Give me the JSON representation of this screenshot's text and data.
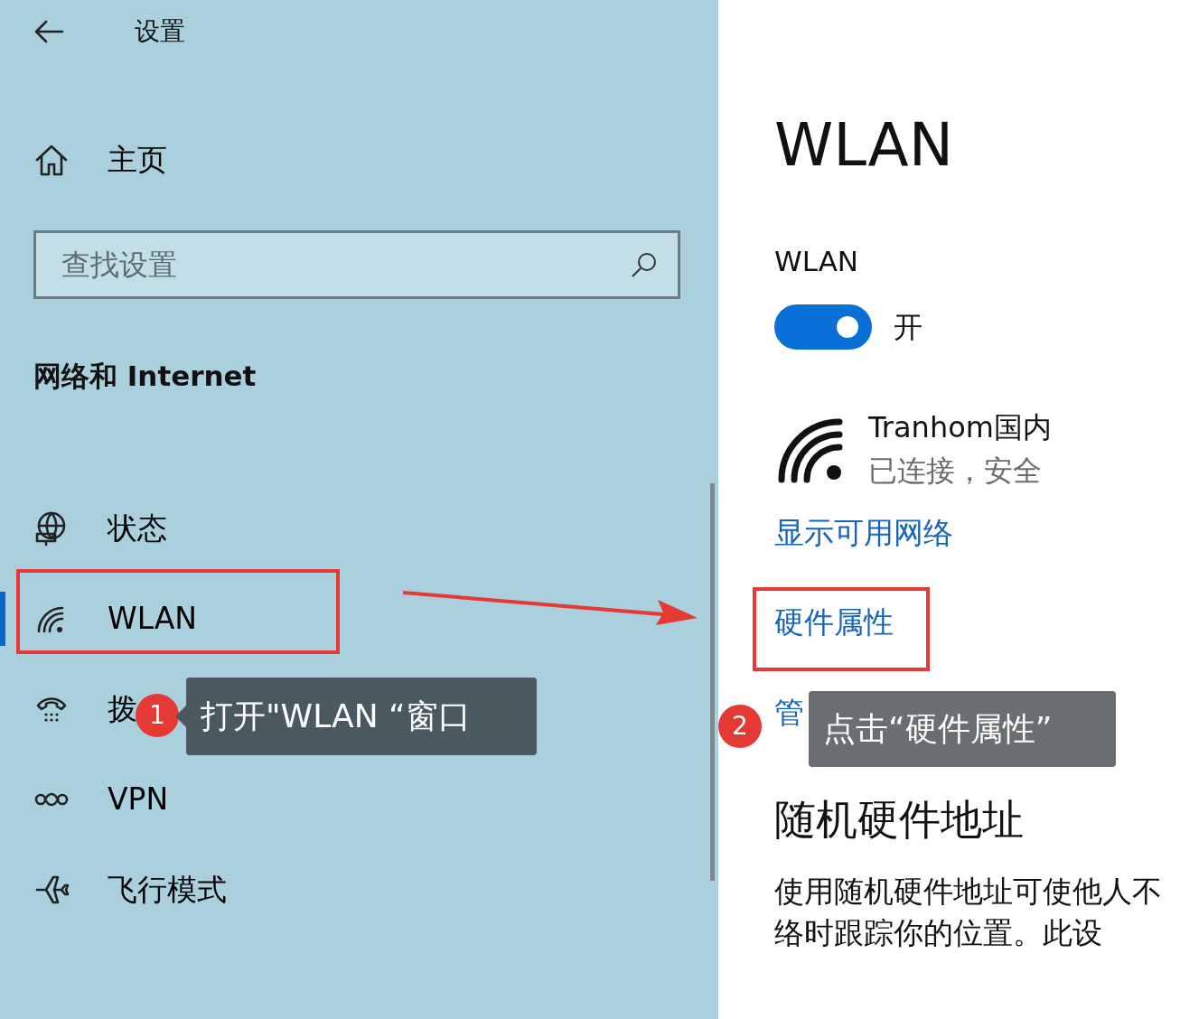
{
  "header": {
    "title": "设置"
  },
  "home": {
    "label": "主页"
  },
  "search": {
    "placeholder": "查找设置"
  },
  "section_title": "网络和 Internet",
  "nav_items": [
    {
      "kind": "status",
      "label": "状态",
      "selected": false
    },
    {
      "kind": "wifi",
      "label": "WLAN",
      "selected": true
    },
    {
      "kind": "dialup",
      "label": "拨",
      "selected": false
    },
    {
      "kind": "vpn",
      "label": "VPN",
      "selected": false
    },
    {
      "kind": "airplane",
      "label": "飞行模式",
      "selected": false
    }
  ],
  "page_title": "WLAN",
  "wlan_toggle": {
    "label": "WLAN",
    "on": true,
    "state_text": "开"
  },
  "network": {
    "name": "Tranhom国内",
    "status": "已连接，安全"
  },
  "links": [
    "显示可用网络",
    "硬件属性",
    "管"
  ],
  "random_section": {
    "title": "随机硬件地址",
    "lines": [
      "使用随机硬件地址可使他人不",
      "络时跟踪你的位置。此设"
    ]
  },
  "annotations": [
    {
      "number": "1",
      "text": "打开\"WLAN “窗口"
    },
    {
      "number": "2",
      "text": "点击“硬件属性”"
    }
  ]
}
